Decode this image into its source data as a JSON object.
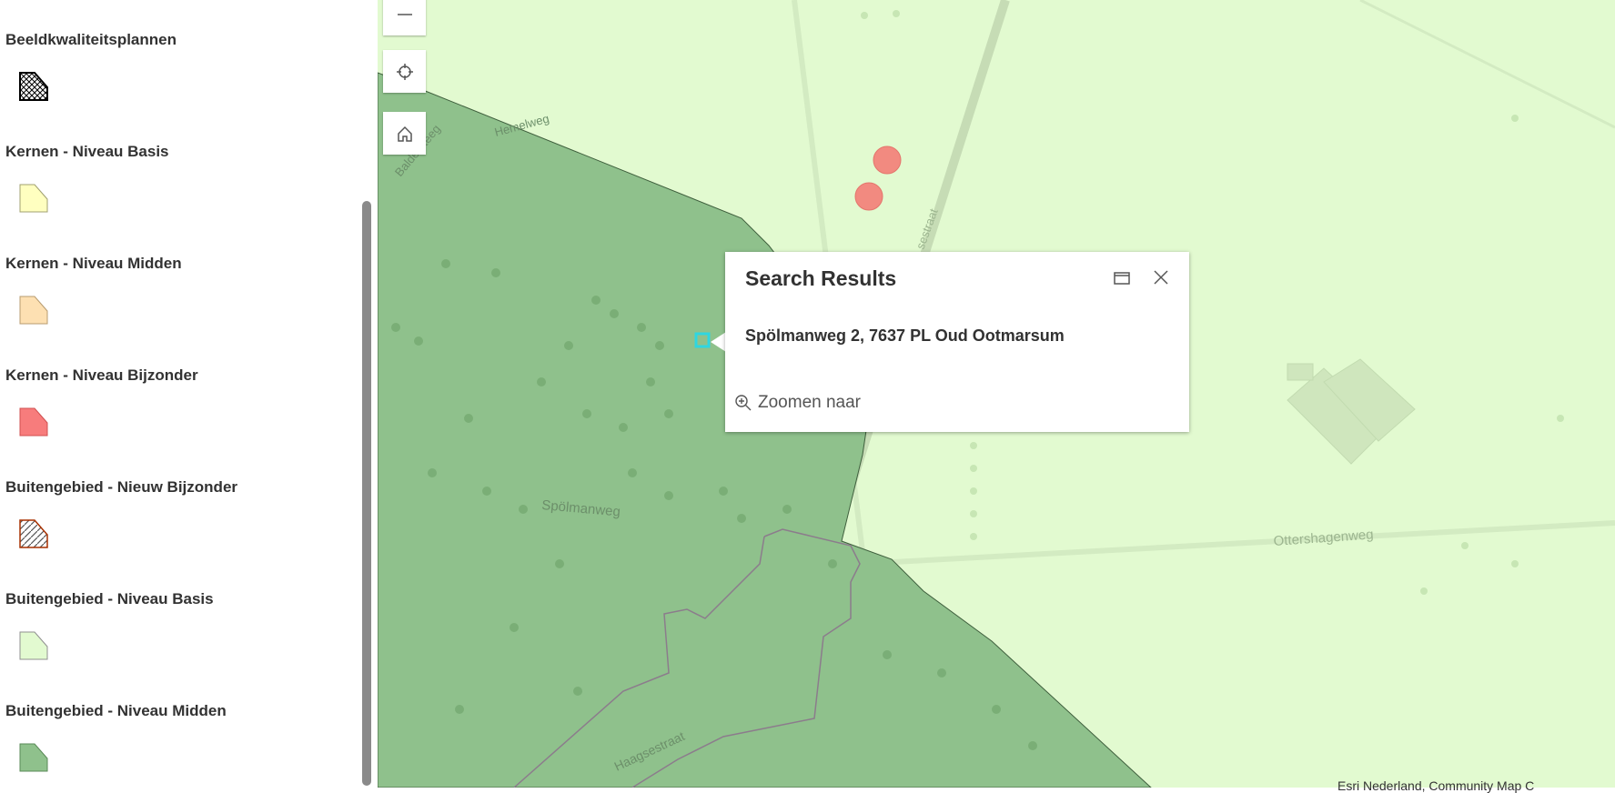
{
  "legend": {
    "items": [
      {
        "label": "Beeldkwaliteitsplannen",
        "swatch": "crosshatch-black",
        "color": "#000000"
      },
      {
        "label": "Kernen - Niveau Basis",
        "swatch": "fill",
        "color": "#ffffc0"
      },
      {
        "label": "Kernen - Niveau Midden",
        "swatch": "fill",
        "color": "#fde0b2"
      },
      {
        "label": "Kernen - Niveau Bijzonder",
        "swatch": "fill",
        "color": "#f77c7c"
      },
      {
        "label": "Buitengebied - Nieuw Bijzonder",
        "swatch": "hatch-red",
        "color": "#a83000"
      },
      {
        "label": "Buitengebied - Niveau Basis",
        "swatch": "fill",
        "color": "#e2fad0"
      },
      {
        "label": "Buitengebied - Niveau Midden",
        "swatch": "fill",
        "color": "#8fc18c"
      }
    ]
  },
  "map_controls": {
    "zoom_out_icon": "minus-icon",
    "locate_icon": "crosshair-icon",
    "home_icon": "home-icon"
  },
  "map": {
    "street_labels": [
      "Spölmanweg",
      "Ottershagenweg",
      "Haagsestraat",
      "Baldersteeg",
      "Hemelweg",
      "sestraat"
    ],
    "colors": {
      "outside": "#e2fad0",
      "midden": "#8fc18c",
      "kern": "#f28a80"
    }
  },
  "popup": {
    "title": "Search Results",
    "address": "Spölmanweg 2, 7637 PL Oud Ootmarsum",
    "zoom_label": "Zoomen naar",
    "dock_icon": "dock-icon",
    "close_icon": "close-icon",
    "zoom_icon": "zoom-in-icon"
  },
  "attribution": "Esri Nederland, Community Map C"
}
